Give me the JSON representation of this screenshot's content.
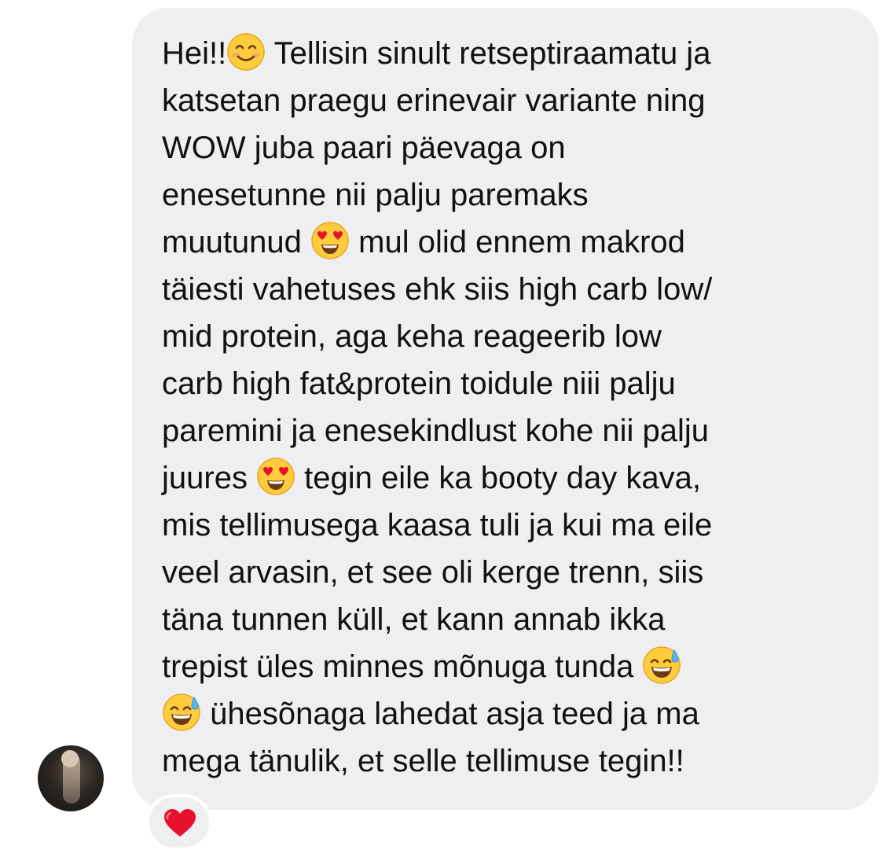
{
  "message": {
    "lines": [
      {
        "segments": [
          {
            "text": "Hei!!"
          },
          {
            "emoji": "smiling-face-icon"
          },
          {
            "text": " Tellisin sinult retseptiraamatu ja"
          }
        ]
      },
      {
        "segments": [
          {
            "text": "katsetan praegu erinevair variante ning"
          }
        ]
      },
      {
        "segments": [
          {
            "text": "WOW juba paari päevaga on"
          }
        ]
      },
      {
        "segments": [
          {
            "text": "enesetunne nii palju paremaks"
          }
        ]
      },
      {
        "segments": [
          {
            "text": "muutunud "
          },
          {
            "emoji": "heart-eyes-icon"
          },
          {
            "text": " mul olid ennem makrod"
          }
        ]
      },
      {
        "segments": [
          {
            "text": "täiesti vahetuses ehk siis high carb low/"
          }
        ]
      },
      {
        "segments": [
          {
            "text": "mid protein, aga keha reageerib low"
          }
        ]
      },
      {
        "segments": [
          {
            "text": "carb high fat&protein toidule niii palju"
          }
        ]
      },
      {
        "segments": [
          {
            "text": "paremini ja enesekindlust kohe nii palju"
          }
        ]
      },
      {
        "segments": [
          {
            "text": "juures "
          },
          {
            "emoji": "heart-eyes-icon"
          },
          {
            "text": " tegin eile ka booty day kava,"
          }
        ]
      },
      {
        "segments": [
          {
            "text": "mis tellimusega kaasa tuli ja kui ma eile"
          }
        ]
      },
      {
        "segments": [
          {
            "text": "veel arvasin, et see oli kerge trenn, siis"
          }
        ]
      },
      {
        "segments": [
          {
            "text": "täna tunnen küll, et kann annab ikka"
          }
        ]
      },
      {
        "segments": [
          {
            "text": "trepist üles minnes mõnuga tunda "
          },
          {
            "emoji": "grinning-sweat-icon"
          }
        ]
      },
      {
        "segments": [
          {
            "emoji": "grinning-sweat-icon"
          },
          {
            "text": " ühesõnaga lahedat asja teed ja ma"
          }
        ]
      },
      {
        "segments": [
          {
            "text": "mega tänulik, et selle tellimuse tegin!!"
          }
        ]
      }
    ]
  },
  "sender": {
    "avatar_icon": "user-avatar"
  },
  "reaction": {
    "icon": "red-heart-icon",
    "color": "#e8112d"
  },
  "colors": {
    "bubble": "#efeff1",
    "text": "#111111",
    "background": "#ffffff"
  }
}
